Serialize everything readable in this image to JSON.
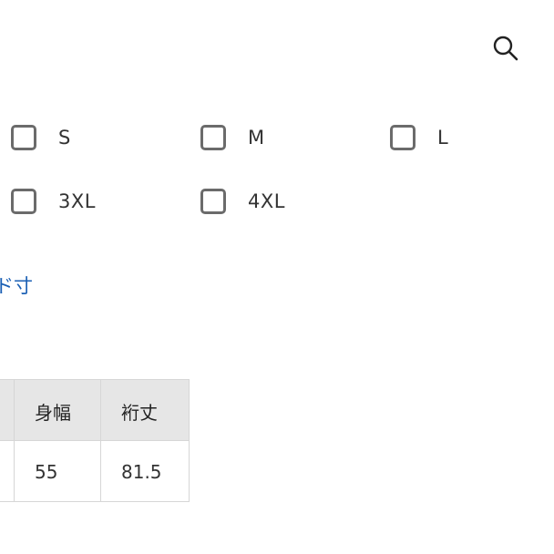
{
  "search": {
    "icon": "search-icon"
  },
  "sizes": {
    "options": [
      {
        "label": "S"
      },
      {
        "label": "M"
      },
      {
        "label": "L"
      },
      {
        "label": "3XL"
      },
      {
        "label": "4XL"
      }
    ]
  },
  "size_link": {
    "label": "ド寸"
  },
  "table": {
    "headers": [
      "",
      "身幅",
      "裄丈"
    ],
    "rows": [
      [
        "",
        "55",
        "81.5"
      ]
    ]
  },
  "colors": {
    "link": "#1a5fb4",
    "checkbox_border": "#6b6b6b",
    "table_header_bg": "#e6e6e6",
    "table_border": "#d6d6d6"
  }
}
